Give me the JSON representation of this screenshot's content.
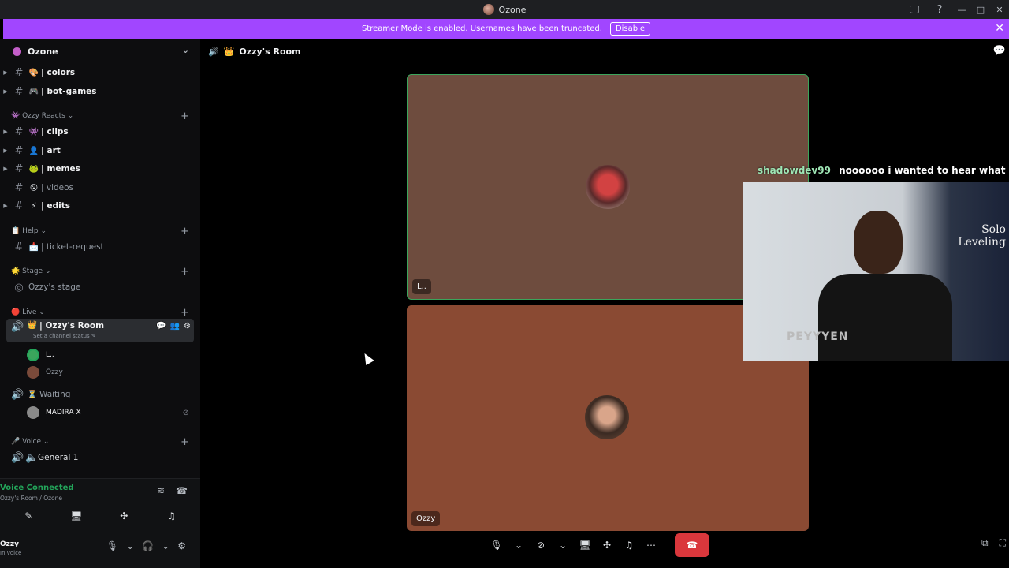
{
  "window": {
    "title": "Ozone",
    "controls": [
      "🖵",
      "?",
      "—",
      "□",
      "✕"
    ]
  },
  "banner": {
    "text": "Streamer Mode is enabled. Usernames have been truncated.",
    "disable_label": "Disable",
    "close_label": "✕"
  },
  "sidebar": {
    "server_name": "Ozone",
    "channels_top": [
      {
        "emoji": "🎨",
        "name": "| colors"
      },
      {
        "emoji": "🎮",
        "name": "| bot-games"
      }
    ],
    "categories": {
      "reacts": "Ozzy Reacts",
      "help": "Help",
      "stage": "Stage",
      "live": "Live",
      "voice": "Voice"
    },
    "react_channels": [
      {
        "emoji": "👾",
        "name": "| clips"
      },
      {
        "emoji": "👤",
        "name": "| art"
      },
      {
        "emoji": "🐸",
        "name": "| memes"
      },
      {
        "emoji": "😮",
        "name": "| videos"
      },
      {
        "emoji": "⚡",
        "name": "| edits"
      }
    ],
    "help_channel": {
      "emoji": "📩",
      "name": "| ticket-request"
    },
    "stage_channel": {
      "name": "Ozzy's stage"
    },
    "live_channel": {
      "emoji": "👑",
      "name": "| Ozzy's Room",
      "status": "Set a channel status ✎",
      "members": [
        "L..",
        "Ozzy"
      ]
    },
    "waiting_channel": {
      "emoji": "⏳",
      "name": "Waiting",
      "member": "MADIRA X"
    },
    "voice_channels": [
      "General 1"
    ]
  },
  "voice_panel": {
    "title": "Voice Connected",
    "subtitle": "Ozzy's Room / Ozone",
    "user_name": "Ozzy",
    "user_status": "In voice"
  },
  "main": {
    "room_title": "Ozzy's Room",
    "room_emoji": "👑",
    "tiles": [
      {
        "label": "L.."
      },
      {
        "label": "Ozzy"
      }
    ]
  },
  "overlay": {
    "chatter": "shadowdev99",
    "message": "noooooo i wanted to hear what he h"
  },
  "webcam": {
    "shirt_text": "PEYYYEN",
    "poster_text_line1": "Solo",
    "poster_text_line2": "Leveling"
  }
}
